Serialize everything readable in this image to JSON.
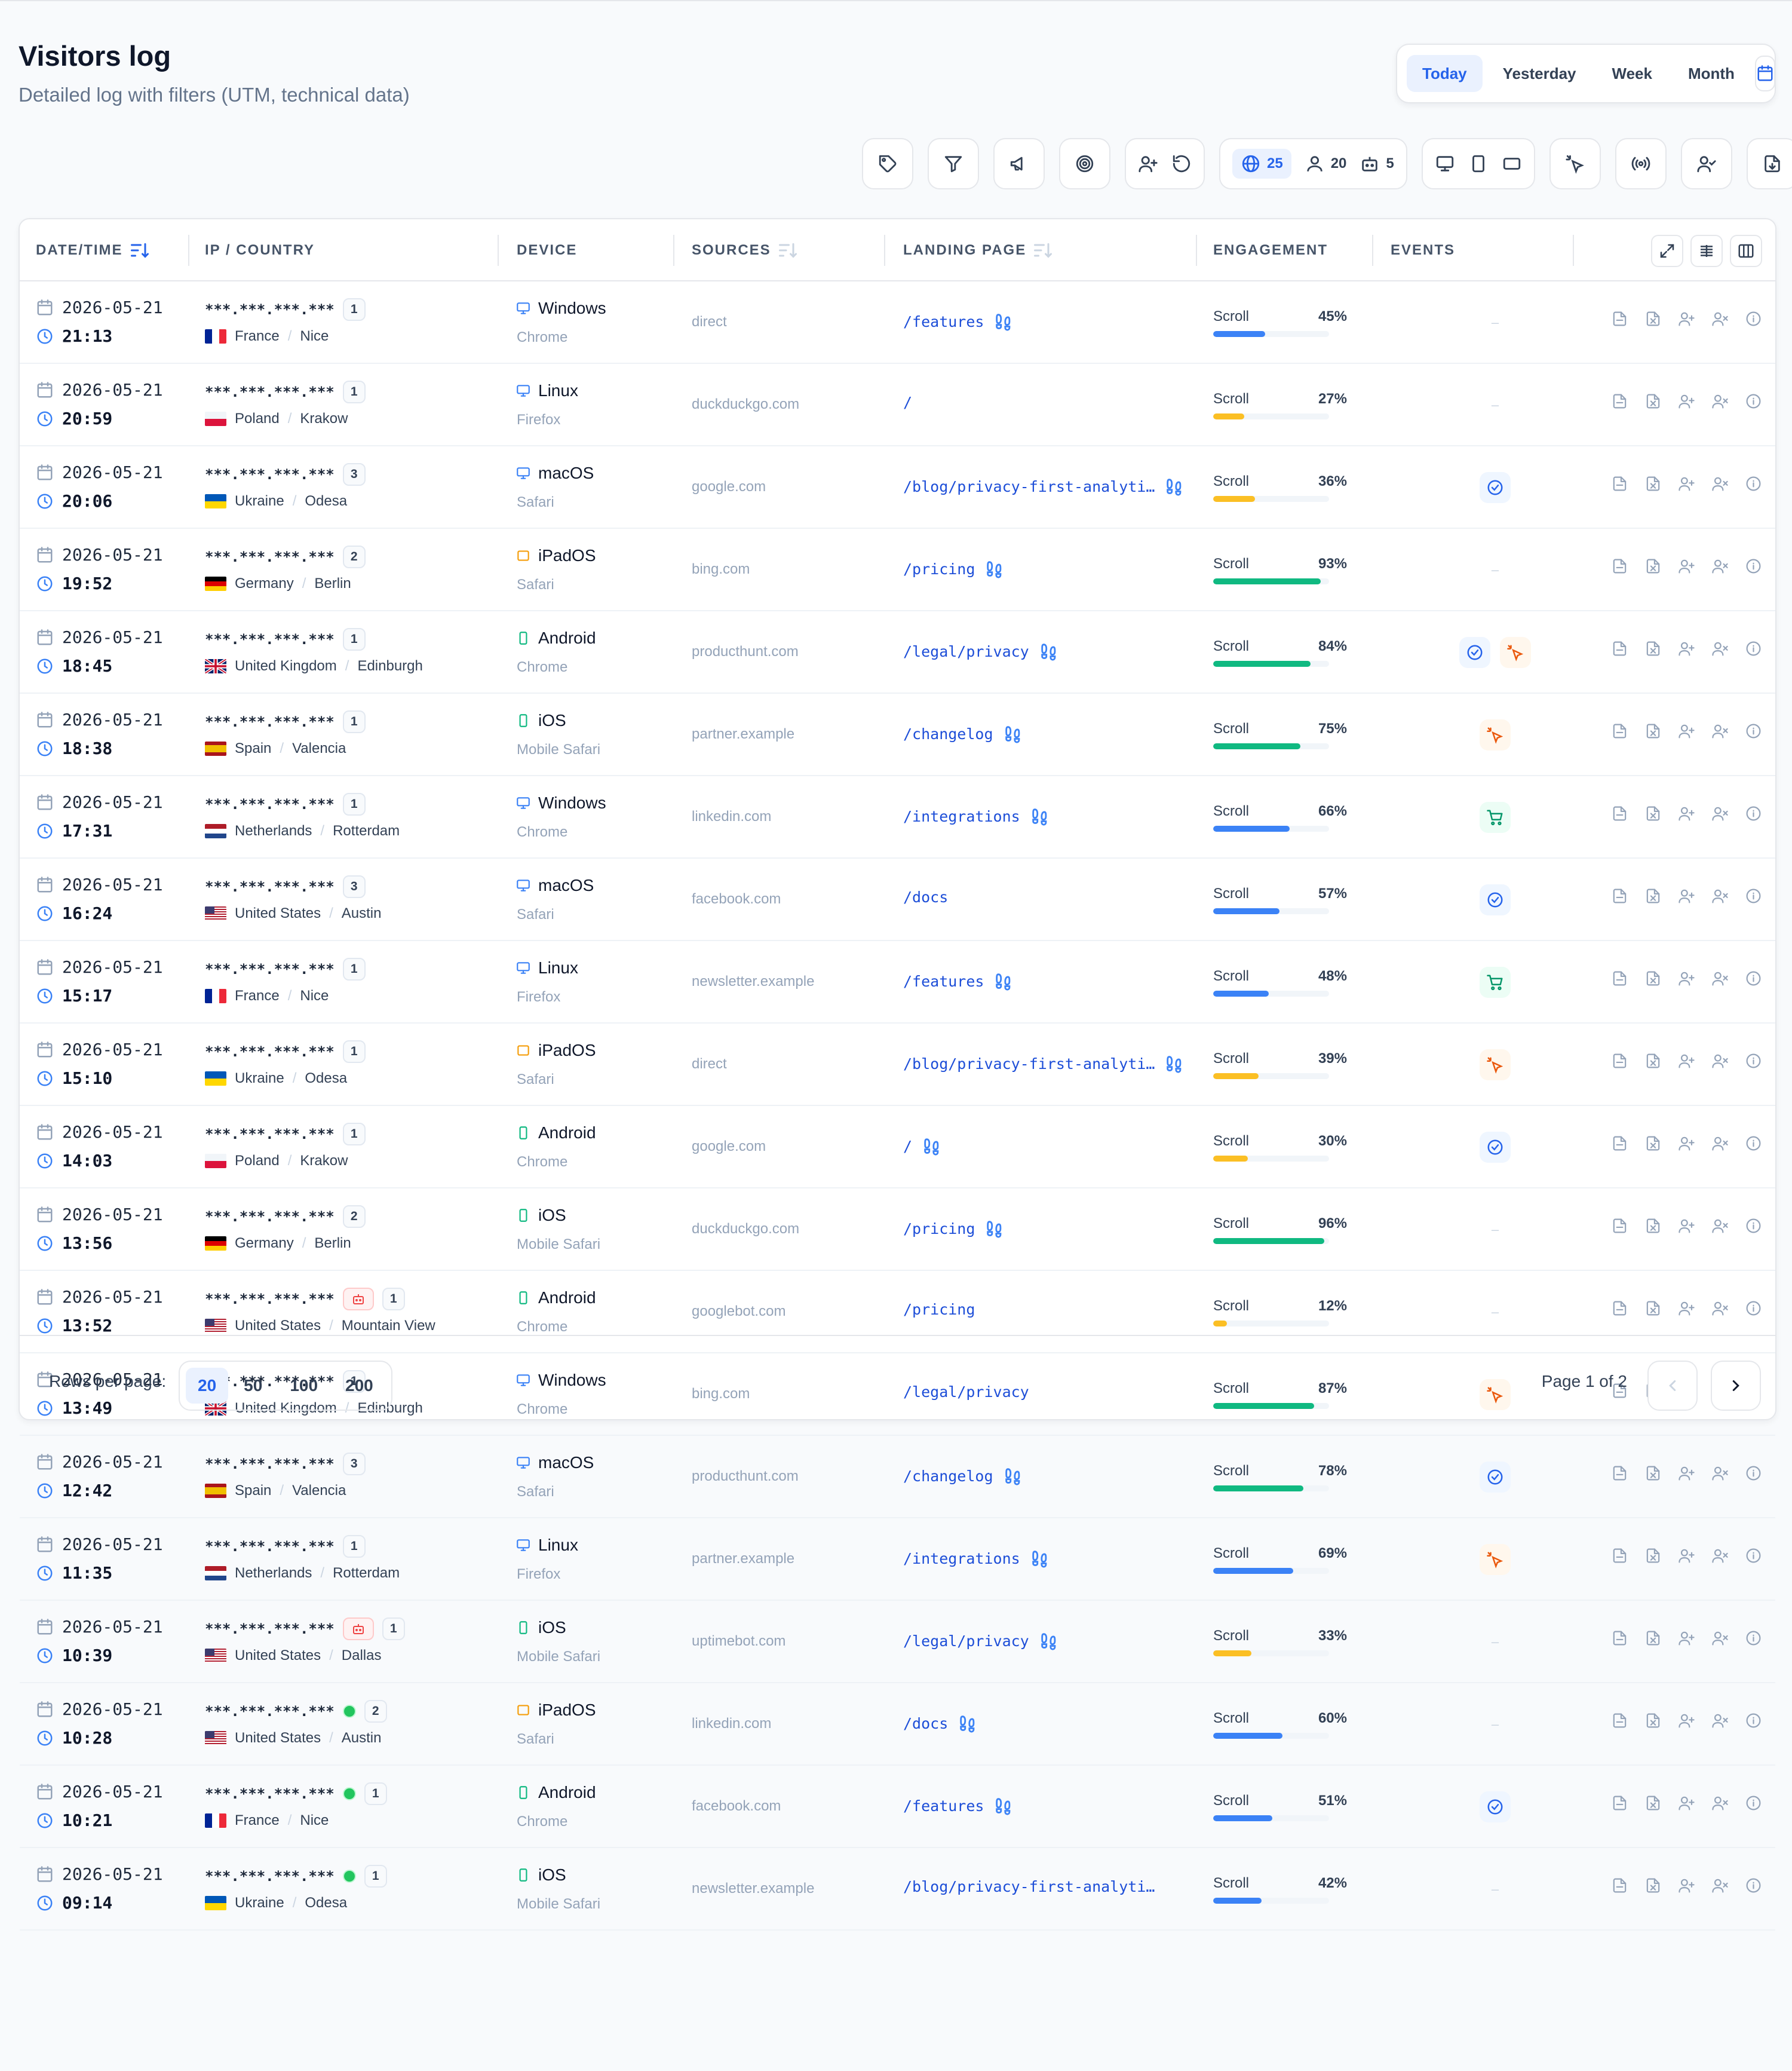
{
  "header": {
    "title": "Visitors log",
    "subtitle": "Detailed log with filters (UTM, technical data)"
  },
  "period": {
    "options": [
      "Today",
      "Yesterday",
      "Week",
      "Month"
    ],
    "active": "Today",
    "calendar_icon": "calendar-icon"
  },
  "toolbar": {
    "buttons": [
      "tag-icon",
      "filter-icon",
      "megaphone-icon",
      "target-icon",
      "user-plus-icon",
      "refresh-icon",
      "desktop-icon",
      "tablet-icon",
      "mobile-landscape-icon",
      "click-icon",
      "broadcast-icon",
      "user-check-icon",
      "export-icon"
    ],
    "stats": {
      "sessions": "25",
      "visitors": "20",
      "bots": "5"
    }
  },
  "table": {
    "columns": {
      "datetime": "DATE/TIME",
      "ip_country": "IP / COUNTRY",
      "device": "DEVICE",
      "sources": "SOURCES",
      "landing": "LANDING PAGE",
      "engagement": "ENGAGEMENT",
      "events": "EVENTS"
    },
    "scroll_label": "Scroll",
    "ip_mask": "***.***.***.***",
    "separator": "/",
    "rows": [
      {
        "date": "2026-05-21",
        "time": "21:13",
        "visits": "1",
        "flag": "none",
        "country": "France",
        "city": "Nice",
        "device_kind": "desktop",
        "os": "Windows",
        "browser": "Chrome",
        "source": "direct",
        "landing": "/features",
        "replay": true,
        "scroll": 45,
        "scroll_pct": "45%",
        "events": []
      },
      {
        "date": "2026-05-21",
        "time": "20:59",
        "visits": "1",
        "flag": "none",
        "country": "Poland",
        "city": "Krakow",
        "device_kind": "desktop",
        "os": "Linux",
        "browser": "Firefox",
        "source": "duckduckgo.com",
        "landing": "/",
        "replay": false,
        "scroll": 27,
        "scroll_pct": "27%",
        "events": []
      },
      {
        "date": "2026-05-21",
        "time": "20:06",
        "visits": "3",
        "flag": "none",
        "country": "Ukraine",
        "city": "Odesa",
        "device_kind": "desktop",
        "os": "macOS",
        "browser": "Safari",
        "source": "google.com",
        "landing": "/blog/privacy-first-analyti…",
        "replay": true,
        "scroll": 36,
        "scroll_pct": "36%",
        "events": [
          "goal"
        ]
      },
      {
        "date": "2026-05-21",
        "time": "19:52",
        "visits": "2",
        "flag": "none",
        "country": "Germany",
        "city": "Berlin",
        "device_kind": "tablet",
        "os": "iPadOS",
        "browser": "Safari",
        "source": "bing.com",
        "landing": "/pricing",
        "replay": true,
        "scroll": 93,
        "scroll_pct": "93%",
        "events": []
      },
      {
        "date": "2026-05-21",
        "time": "18:45",
        "visits": "1",
        "flag": "none",
        "country": "United Kingdom",
        "city": "Edinburgh",
        "device_kind": "mobile",
        "os": "Android",
        "browser": "Chrome",
        "source": "producthunt.com",
        "landing": "/legal/privacy",
        "replay": true,
        "scroll": 84,
        "scroll_pct": "84%",
        "events": [
          "goal",
          "click"
        ]
      },
      {
        "date": "2026-05-21",
        "time": "18:38",
        "visits": "1",
        "flag": "none",
        "country": "Spain",
        "city": "Valencia",
        "device_kind": "mobile",
        "os": "iOS",
        "browser": "Mobile Safari",
        "source": "partner.example",
        "landing": "/changelog",
        "replay": true,
        "scroll": 75,
        "scroll_pct": "75%",
        "events": [
          "click"
        ]
      },
      {
        "date": "2026-05-21",
        "time": "17:31",
        "visits": "1",
        "flag": "none",
        "country": "Netherlands",
        "city": "Rotterdam",
        "device_kind": "desktop",
        "os": "Windows",
        "browser": "Chrome",
        "source": "linkedin.com",
        "landing": "/integrations",
        "replay": true,
        "scroll": 66,
        "scroll_pct": "66%",
        "events": [
          "cart"
        ]
      },
      {
        "date": "2026-05-21",
        "time": "16:24",
        "visits": "3",
        "flag": "none",
        "country": "United States",
        "city": "Austin",
        "device_kind": "desktop",
        "os": "macOS",
        "browser": "Safari",
        "source": "facebook.com",
        "landing": "/docs",
        "replay": false,
        "scroll": 57,
        "scroll_pct": "57%",
        "events": [
          "goal"
        ]
      },
      {
        "date": "2026-05-21",
        "time": "15:17",
        "visits": "1",
        "flag": "none",
        "country": "France",
        "city": "Nice",
        "device_kind": "desktop",
        "os": "Linux",
        "browser": "Firefox",
        "source": "newsletter.example",
        "landing": "/features",
        "replay": true,
        "scroll": 48,
        "scroll_pct": "48%",
        "events": [
          "cart"
        ]
      },
      {
        "date": "2026-05-21",
        "time": "15:10",
        "visits": "1",
        "flag": "none",
        "country": "Ukraine",
        "city": "Odesa",
        "device_kind": "tablet",
        "os": "iPadOS",
        "browser": "Safari",
        "source": "direct",
        "landing": "/blog/privacy-first-analyti…",
        "replay": true,
        "scroll": 39,
        "scroll_pct": "39%",
        "events": [
          "click"
        ]
      },
      {
        "date": "2026-05-21",
        "time": "14:03",
        "visits": "1",
        "flag": "none",
        "country": "Poland",
        "city": "Krakow",
        "device_kind": "mobile",
        "os": "Android",
        "browser": "Chrome",
        "source": "google.com",
        "landing": "/",
        "replay": true,
        "scroll": 30,
        "scroll_pct": "30%",
        "events": [
          "goal"
        ]
      },
      {
        "date": "2026-05-21",
        "time": "13:56",
        "visits": "2",
        "flag": "none",
        "country": "Germany",
        "city": "Berlin",
        "device_kind": "mobile",
        "os": "iOS",
        "browser": "Mobile Safari",
        "source": "duckduckgo.com",
        "landing": "/pricing",
        "replay": true,
        "scroll": 96,
        "scroll_pct": "96%",
        "events": []
      },
      {
        "date": "2026-05-21",
        "time": "13:52",
        "visits": "1",
        "flag": "bot",
        "country": "United States",
        "city": "Mountain View",
        "device_kind": "mobile",
        "os": "Android",
        "browser": "Chrome",
        "source": "googlebot.com",
        "landing": "/pricing",
        "replay": false,
        "scroll": 12,
        "scroll_pct": "12%",
        "events": []
      },
      {
        "date": "2026-05-21",
        "time": "13:49",
        "visits": "1",
        "flag": "none",
        "country": "United Kingdom",
        "city": "Edinburgh",
        "device_kind": "desktop",
        "os": "Windows",
        "browser": "Chrome",
        "source": "bing.com",
        "landing": "/legal/privacy",
        "replay": false,
        "scroll": 87,
        "scroll_pct": "87%",
        "events": [
          "click"
        ]
      },
      {
        "date": "2026-05-21",
        "time": "12:42",
        "visits": "3",
        "flag": "none",
        "country": "Spain",
        "city": "Valencia",
        "device_kind": "desktop",
        "os": "macOS",
        "browser": "Safari",
        "source": "producthunt.com",
        "landing": "/changelog",
        "replay": true,
        "scroll": 78,
        "scroll_pct": "78%",
        "events": [
          "goal"
        ]
      },
      {
        "date": "2026-05-21",
        "time": "11:35",
        "visits": "1",
        "flag": "none",
        "country": "Netherlands",
        "city": "Rotterdam",
        "device_kind": "desktop",
        "os": "Linux",
        "browser": "Firefox",
        "source": "partner.example",
        "landing": "/integrations",
        "replay": true,
        "scroll": 69,
        "scroll_pct": "69%",
        "events": [
          "click"
        ]
      },
      {
        "date": "2026-05-21",
        "time": "10:39",
        "visits": "1",
        "flag": "bot",
        "country": "United States",
        "city": "Dallas",
        "device_kind": "mobile",
        "os": "iOS",
        "browser": "Mobile Safari",
        "source": "uptimebot.com",
        "landing": "/legal/privacy",
        "replay": true,
        "scroll": 33,
        "scroll_pct": "33%",
        "events": []
      },
      {
        "date": "2026-05-21",
        "time": "10:28",
        "visits": "2",
        "flag": "online",
        "country": "United States",
        "city": "Austin",
        "device_kind": "tablet",
        "os": "iPadOS",
        "browser": "Safari",
        "source": "linkedin.com",
        "landing": "/docs",
        "replay": true,
        "scroll": 60,
        "scroll_pct": "60%",
        "events": []
      },
      {
        "date": "2026-05-21",
        "time": "10:21",
        "visits": "1",
        "flag": "online",
        "country": "France",
        "city": "Nice",
        "device_kind": "mobile",
        "os": "Android",
        "browser": "Chrome",
        "source": "facebook.com",
        "landing": "/features",
        "replay": true,
        "scroll": 51,
        "scroll_pct": "51%",
        "events": [
          "goal"
        ]
      },
      {
        "date": "2026-05-21",
        "time": "09:14",
        "visits": "1",
        "flag": "online",
        "country": "Ukraine",
        "city": "Odesa",
        "device_kind": "mobile",
        "os": "iOS",
        "browser": "Mobile Safari",
        "source": "newsletter.example",
        "landing": "/blog/privacy-first-analyti…",
        "replay": false,
        "scroll": 42,
        "scroll_pct": "42%",
        "events": []
      }
    ]
  },
  "footer": {
    "rows_per_page_label": "Rows per page:",
    "rows_per_page_options": [
      "20",
      "50",
      "100",
      "200"
    ],
    "rows_per_page_active": "20",
    "page_info": "Page 1 of 2"
  },
  "colors": {
    "accent": "#2563eb",
    "scroll_high": "#10b981",
    "scroll_mid": "#3b82f6",
    "scroll_low": "#fbbf24"
  }
}
